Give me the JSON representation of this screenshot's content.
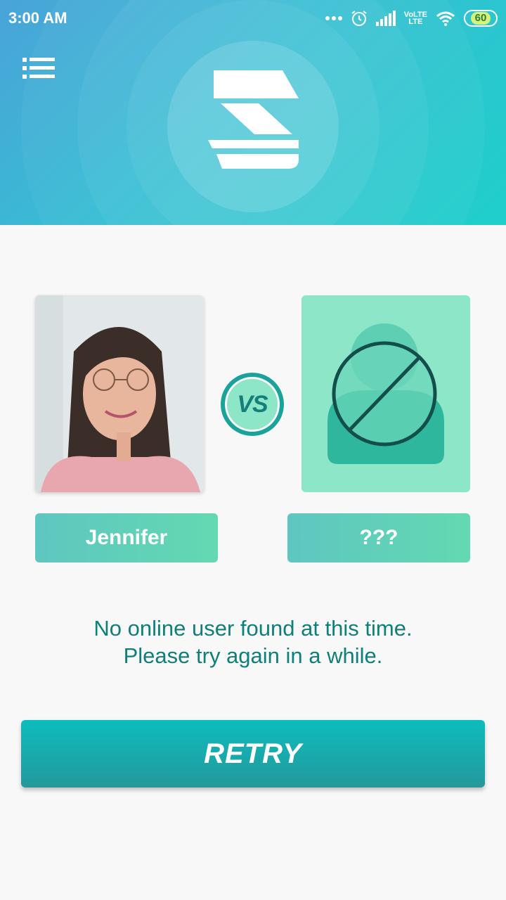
{
  "status_bar": {
    "time": "3:00 AM",
    "network": "VoLTE",
    "network_sub": "LTE",
    "battery": "60",
    "icons": [
      "dots-icon",
      "alarm-icon",
      "signal-icon",
      "volte-icon",
      "wifi-icon",
      "battery-icon"
    ]
  },
  "header": {
    "menu_icon": "list-menu-icon",
    "logo_icon": "app-logo"
  },
  "match": {
    "player_one": {
      "name": "Jennifer",
      "photo": "user-photo"
    },
    "vs_label": "VS",
    "player_two": {
      "name": "???",
      "photo": "no-user-icon"
    }
  },
  "message": {
    "line1": "No online user found at this time.",
    "line2": "Please try again in a while."
  },
  "actions": {
    "retry_label": "RETRY"
  },
  "colors": {
    "accent": "#1aa39a",
    "text_teal": "#0f7f7a",
    "card_mint": "#8ee6c9",
    "header_start": "#4aa3d8",
    "header_end": "#1fcfcb"
  }
}
